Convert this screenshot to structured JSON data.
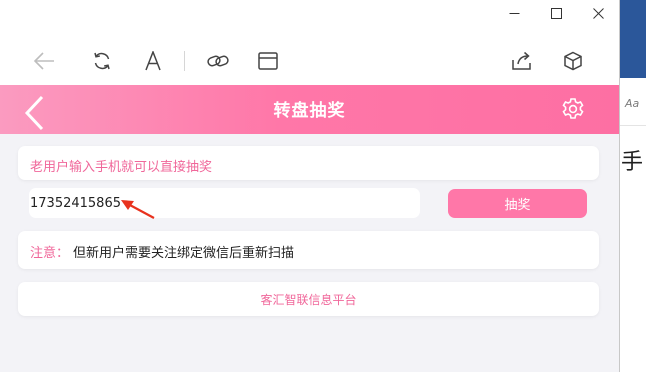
{
  "window": {
    "controls": [
      "minimize",
      "maximize",
      "close"
    ]
  },
  "toolbar": {
    "icons": [
      "back-arrow-icon",
      "refresh-icon",
      "font-size-icon",
      "link-icon",
      "window-icon",
      "share-icon",
      "cube-icon"
    ]
  },
  "header": {
    "title": "转盘抽奖",
    "icons": [
      "chevron-left-icon",
      "gear-icon"
    ]
  },
  "form": {
    "notice": "老用户输入手机就可以直接抽奖",
    "phone_value": "17352415865",
    "draw_button": "抽奖"
  },
  "note": {
    "label": "注意：",
    "text": "但新用户需要关注绑定微信后重新扫描"
  },
  "footer": {
    "text": "客汇智联信息平台"
  },
  "background_window": {
    "partial_text_1": "Aa",
    "partial_text_2": "手"
  },
  "colors": {
    "accent": "#ff77a8",
    "accent_text": "#f0679a",
    "page_bg": "#f3f3f7",
    "annotation_arrow": "#e8321e"
  }
}
